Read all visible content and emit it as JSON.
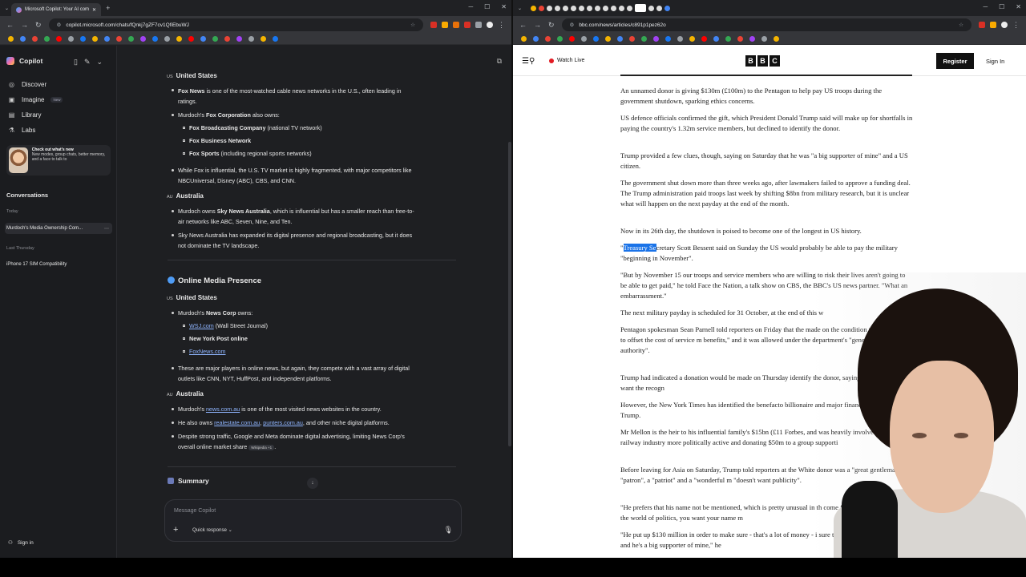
{
  "left_browser": {
    "tabs": [
      {
        "label": "Microsoft Copilot: Your AI com"
      }
    ],
    "new_tab": "+",
    "url": "copilot.microsoft.com/chats/fQnkj7gZF7cv1QfiEbuWJ"
  },
  "copilot": {
    "app_name": "Copilot",
    "nav": [
      {
        "label": "Discover",
        "icon": "compass-icon"
      },
      {
        "label": "Imagine",
        "icon": "image-icon",
        "badge": "New"
      },
      {
        "label": "Library",
        "icon": "library-icon"
      },
      {
        "label": "Labs",
        "icon": "flask-icon"
      }
    ],
    "promo": {
      "title": "Check out what's new",
      "body": "New modes, group chats, better memory, and a face to talk to"
    },
    "conversations_heading": "Conversations",
    "today_label": "Today",
    "today_items": [
      "Murdoch's Media Ownership Com..."
    ],
    "last_thursday_label": "Last Thursday",
    "last_thursday_items": [
      "iPhone 17 SIM Compatibility"
    ],
    "sign_in": "Sign in",
    "message_placeholder": "Message Copilot",
    "quick_response": "Quick response",
    "summary_label": "Summary"
  },
  "chat": {
    "us1": {
      "cc": "US",
      "heading": "United States"
    },
    "fox1": {
      "bold": "Fox News",
      "rest": " is one of the most-watched cable news networks in the U.S., often leading in",
      "line2": "ratings."
    },
    "foxcorp": {
      "pre": "Murdoch's ",
      "bold": "Fox Corporation",
      "rest": " also owns:"
    },
    "foxcorp_items": [
      {
        "bold": "Fox Broadcasting Company",
        "rest": " (national TV network)"
      },
      {
        "bold": "Fox Business Network",
        "rest": ""
      },
      {
        "bold": "Fox Sports",
        "rest": " (including regional sports networks)"
      }
    ],
    "fragmented": {
      "line1": "While Fox is influential, the U.S. TV market is highly fragmented, with major competitors like",
      "line2": "NBCUniversal, Disney (ABC), CBS, and CNN."
    },
    "au1": {
      "cc": "AU",
      "heading": "Australia"
    },
    "sky1": {
      "pre": "Murdoch owns ",
      "bold": "Sky News Australia",
      "rest": ", which is influential but has a smaller reach than free-to-",
      "line2": "air networks like ABC, Seven, Nine, and Ten."
    },
    "sky2": {
      "line1": "Sky News Australia has expanded its digital presence and regional broadcasting, but it does",
      "line2": "not dominate the TV landscape."
    },
    "online_heading": "Online Media Presence",
    "us2": {
      "cc": "US",
      "heading": "United States"
    },
    "newscorp": {
      "pre": "Murdoch's ",
      "bold": "News Corp",
      "rest": " owns:"
    },
    "newscorp_items": [
      {
        "link": "WSJ.com",
        "rest": " (Wall Street Journal)"
      },
      {
        "bold": "New York Post online"
      },
      {
        "link": "FoxNews.com"
      }
    ],
    "major": {
      "line1": "These are major players in online news, but again, they compete with a vast array of digital",
      "line2": "outlets like CNN, NYT, HuffPost, and independent platforms."
    },
    "au2": {
      "cc": "AU",
      "heading": "Australia"
    },
    "newscomau": {
      "pre": "Murdoch's ",
      "link": "news.com.au",
      "rest": " is one of the most visited news websites in the country."
    },
    "owns": {
      "pre": "He also owns ",
      "link1": "realestate.com.au",
      "sep": ", ",
      "link2": "punters.com.au",
      "rest": ", and other niche digital platforms."
    },
    "despite": {
      "line1": "Despite strong traffic, Google and Meta dominate digital advertising, limiting News Corp's",
      "line2": "overall online market share",
      "cite": "Wikipedia +1",
      "end": "."
    }
  },
  "right_browser": {
    "url": "bbc.com/news/articles/c891p1pez62o",
    "tab_count_label": "BBC News tabs"
  },
  "bbc": {
    "watch_live": "Watch Live",
    "logo": [
      "B",
      "B",
      "C"
    ],
    "register": "Register",
    "sign_in": "Sign In",
    "paragraphs": [
      "An unnamed donor is giving $130m (£100m) to the Pentagon to help pay US troops during the government shutdown, sparking ethics concerns.",
      "US defence officials confirmed the gift, which President Donald Trump said will make up for shortfalls in paying the country's 1.32m service members, but declined to identify the donor.",
      "Trump provided a few clues, though, saying on Saturday that he was \"a big supporter of mine\" and a US citizen.",
      "The government shut down more than three weeks ago, after lawmakers failed to approve a funding deal. The Trump administration paid troops last week by shifting $8bn from military research, but it is unclear what will happen on the next payday at the end of the month.",
      "Now in its 26th day, the shutdown is poised to become one of the longest in US history."
    ],
    "treasury_highlight": "Treasury Se",
    "treasury_rest": "cretary Scott Bessent said on Sunday the US would probably be able to pay the military \"beginning in November\".",
    "treasury_open": "\"",
    "more_paragraphs": [
      "\"But by November 15 our troops and service members who are willing to risk their lives aren't going to be able to get paid,\" he told Face the Nation, a talk show on CBS, the BBC's US news partner. \"What an embarrassment.\"",
      "The next military payday is scheduled for 31 October, at the end of this w",
      "Pentagon spokesman Sean Parnell told reporters on Friday that the made on the condition that it be used to offset the cost of service m benefits,\" and it was allowed under the department's \"general gift authority\".",
      "Trump had indicated a donation would be made on Thursday identify the donor, saying \"he doesn't really want the recogn",
      "However, the New York Times has identified the benefacto billionaire and major financial backer of Trump.",
      "Mr Mellon is the heir to his influential family's $15bn (£11 Forbes, and was heavily involved in the US railway industry more politically active and donating $50m to a group supporti",
      "Before leaving for Asia on Saturday, Trump told reporters at the White donor was a \"great gentleman\", a \"patron\", a \"patriot\" and a \"wonderful m \"doesn't want publicity\".",
      "\"He prefers that his name not be mentioned, which is pretty unusual in th come from,\" Trump said. \"In the world of politics, you want your name m",
      "\"He put up $130 million in order to make sure - that's a lot of money - i sure that the military got paid, and he's a big supporter of mine,\" he"
    ]
  }
}
